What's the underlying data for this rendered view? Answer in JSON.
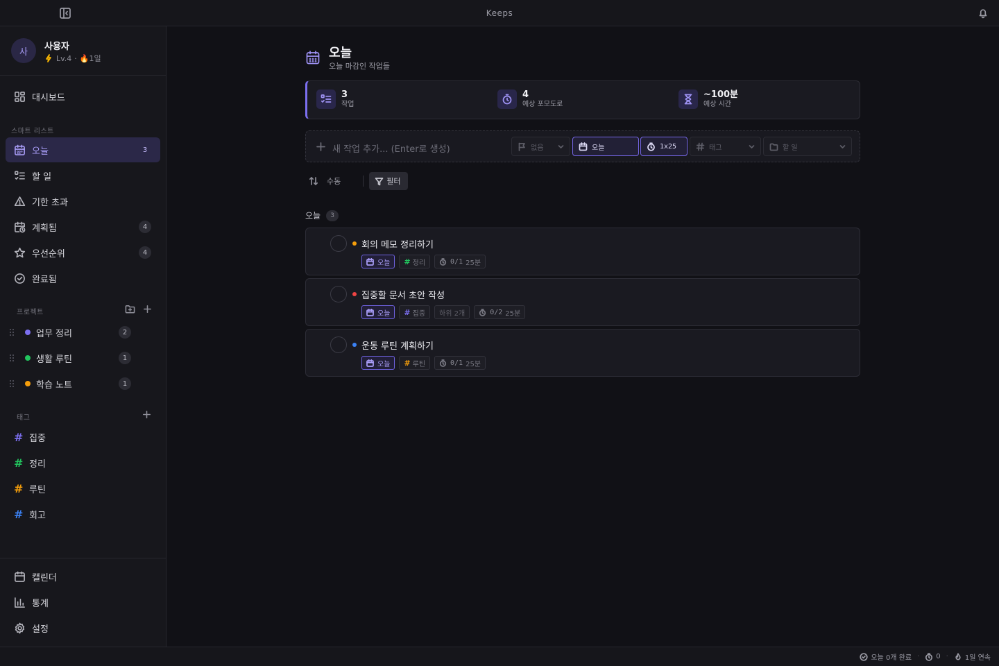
{
  "app": {
    "title": "Keeps"
  },
  "user": {
    "avatar": "사",
    "name": "사용자",
    "level": "Lv.4",
    "sep": "·",
    "streak": "🔥1일"
  },
  "nav": {
    "dashboard": "대시보드"
  },
  "smart_lists": {
    "label": "스마트 리스트",
    "items": [
      {
        "label": "오늘",
        "count": "3",
        "active": true
      },
      {
        "label": "할 일",
        "count": ""
      },
      {
        "label": "기한 초과",
        "count": ""
      },
      {
        "label": "계획됨",
        "count": "4"
      },
      {
        "label": "우선순위",
        "count": "4"
      },
      {
        "label": "완료됨",
        "count": ""
      }
    ]
  },
  "projects": {
    "label": "프로젝트",
    "items": [
      {
        "label": "업무 정리",
        "count": "2",
        "color": "#7c6ff0"
      },
      {
        "label": "생활 루틴",
        "count": "1",
        "color": "#22c55e"
      },
      {
        "label": "학습 노트",
        "count": "1",
        "color": "#f59e0b"
      }
    ]
  },
  "tags": {
    "label": "태그",
    "items": [
      {
        "label": "집중",
        "color": "#7c6ff0"
      },
      {
        "label": "정리",
        "color": "#22c55e"
      },
      {
        "label": "루틴",
        "color": "#f59e0b"
      },
      {
        "label": "회고",
        "color": "#3b82f6"
      }
    ]
  },
  "bottom_nav": {
    "calendar": "캘린더",
    "stats": "통계",
    "settings": "설정"
  },
  "page": {
    "title": "오늘",
    "subtitle": "오늘 마감인 작업들"
  },
  "stats": [
    {
      "value": "3",
      "label": "작업"
    },
    {
      "value": "4",
      "label": "예상 포모도로"
    },
    {
      "value": "~100분",
      "label": "예상 시간"
    }
  ],
  "add_task": {
    "placeholder": "새 작업 추가... (Enter로 생성)",
    "priority": "없음",
    "date": "오늘",
    "pomodoro": "1x25",
    "tag": "태그",
    "list": "할 일"
  },
  "toolbar": {
    "sort": "수동",
    "filter": "필터"
  },
  "group": {
    "label": "오늘",
    "count": "3"
  },
  "tasks": [
    {
      "title": "회의 메모 정리하기",
      "priority_color": "#f59e0b",
      "date": "오늘",
      "tag": "정리",
      "tag_color": "#22c55e",
      "subtasks": "",
      "pomo": "0/1",
      "duration": "25분"
    },
    {
      "title": "집중할 문서 초안 작성",
      "priority_color": "#ef4444",
      "date": "오늘",
      "tag": "집중",
      "tag_color": "#7c6ff0",
      "subtasks": "하위 2개",
      "pomo": "0/2",
      "duration": "25분"
    },
    {
      "title": "운동 루틴 계획하기",
      "priority_color": "#3b82f6",
      "date": "오늘",
      "tag": "루틴",
      "tag_color": "#f59e0b",
      "subtasks": "",
      "pomo": "0/1",
      "duration": "25분"
    }
  ],
  "status": {
    "done_today": "오늘 0개 완료",
    "sep": "·",
    "pomodoros": "0",
    "streak": "1일 연속"
  }
}
